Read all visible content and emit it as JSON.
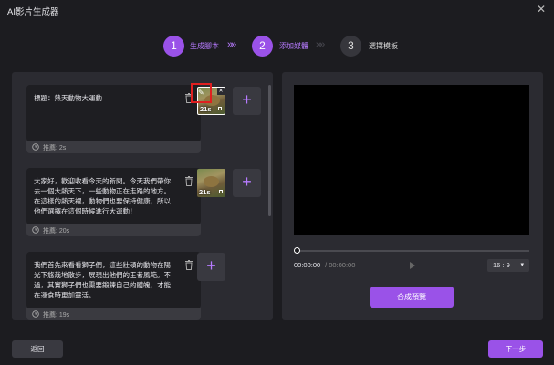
{
  "window": {
    "title": "AI影片生成器",
    "close_glyph": "✕"
  },
  "steps": [
    {
      "number": "1",
      "label": "生成腳本",
      "state": "active"
    },
    {
      "number": "2",
      "label": "添加媒體",
      "state": "active"
    },
    {
      "number": "3",
      "label": "選擇模板",
      "state": "inactive"
    }
  ],
  "step_separator": "»",
  "segments": [
    {
      "text": "標題：熱天動物大運動",
      "duration": "推薦: 2s",
      "media_duration": "21s"
    },
    {
      "text": "大家好，歡迎收看今天的新聞。今天我們帶你去一個大熱天下，一些動物正在走路的地方。在這樣的熱天裡，動物們也要保持健康，所以他們選擇在這個時候進行大運動！",
      "duration": "推薦: 20s",
      "media_duration": "21s"
    },
    {
      "text": "我們首先來看看獅子們，這些壯碩的動物在陽光下悠哉地散步，展現出他們的王者風範。不過，其實獅子們也需要鍛鍊自己的體魄，才能在運食時更加靈活。",
      "duration": "推薦: 19s"
    }
  ],
  "add_media_glyph": "+",
  "player": {
    "current_time": "00:00:00",
    "separator": "/",
    "total_time": "00:00:00",
    "aspect_ratio": "16 : 9",
    "caret": "▾",
    "progress": 0
  },
  "buttons": {
    "preview": "合成預覽",
    "back": "返回",
    "next": "下一步"
  },
  "colors": {
    "accent": "#9a52e8",
    "accent_text": "#b77bff",
    "background": "#1c1c20",
    "panel": "#2b2b31",
    "highlight_box": "#e02020"
  },
  "icons": [
    "close-icon",
    "chevron-double-right-icon",
    "trash-icon",
    "clock-icon",
    "edit-icon",
    "video-icon",
    "plus-icon",
    "play-icon",
    "dropdown-caret-icon"
  ]
}
